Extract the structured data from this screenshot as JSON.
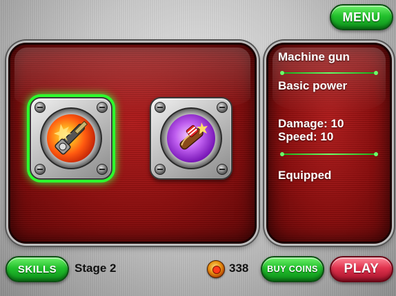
{
  "header": {
    "menu_label": "MENU"
  },
  "weapons": [
    {
      "name": "machine-gun",
      "selected": true
    },
    {
      "name": "firecracker-rocket",
      "selected": false
    }
  ],
  "info": {
    "weapon_name": "Machine gun",
    "power": "Basic power",
    "damage": "Damage: 10",
    "speed": "Speed: 10",
    "status": "Equipped"
  },
  "footer": {
    "skills_label": "SKILLS",
    "stage": "Stage 2",
    "coins": "338",
    "buy_coins_label": "BUY COINS",
    "play_label": "PLAY"
  },
  "colors": {
    "panel_red": "#8a0d0d",
    "button_green": "#22c02c",
    "play_red": "#e0334e",
    "highlight_green": "#2dff2d"
  },
  "icons": [
    "coin-icon",
    "machine-gun-icon",
    "firecracker-rocket-icon",
    "screw-icon"
  ]
}
